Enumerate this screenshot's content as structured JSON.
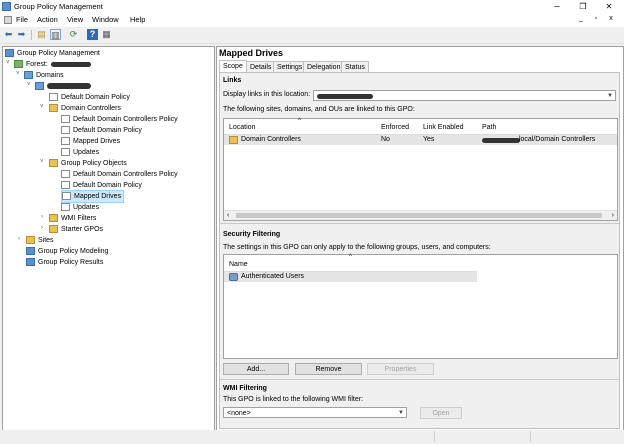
{
  "window": {
    "title": "Group Policy Management",
    "minimize": "─",
    "restore": "❐",
    "close": "✕"
  },
  "menu": {
    "items": [
      "File",
      "Action",
      "View",
      "Window",
      "Help"
    ],
    "mdi_min": "_",
    "mdi_restore": "▫",
    "mdi_close": "x"
  },
  "toolbar": {
    "back": "⬅",
    "forward": "➡",
    "up": "▤",
    "show_hide": "▥",
    "refresh": "⟳",
    "help": "?",
    "console": "▦"
  },
  "tree": {
    "root": "Group Policy Management",
    "forest": "Forest:",
    "domains": "Domains",
    "domain_name": "",
    "default_domain_policy": "Default Domain Policy",
    "domain_controllers": "Domain Controllers",
    "dc_items": [
      "Default Domain Controllers Policy",
      "Default Domain Policy",
      "Mapped Drives",
      "Updates"
    ],
    "gpo_folder": "Group Policy Objects",
    "gpo_items": [
      "Default Domain Controllers Policy",
      "Default Domain Policy",
      "Mapped Drives",
      "Updates"
    ],
    "wmi_filters": "WMI Filters",
    "starter_gpos": "Starter GPOs",
    "sites": "Sites",
    "modeling": "Group Policy Modeling",
    "results": "Group Policy Results"
  },
  "details": {
    "title": "Mapped Drives",
    "tabs": [
      "Scope",
      "Details",
      "Settings",
      "Delegation",
      "Status"
    ],
    "links": {
      "heading": "Links",
      "display_label": "Display links in this location:",
      "display_value": "",
      "desc": "The following sites, domains, and OUs are linked to this GPO:",
      "columns": [
        "Location",
        "Enforced",
        "Link Enabled",
        "Path"
      ],
      "rows": [
        {
          "location": "Domain Controllers",
          "enforced": "No",
          "link_enabled": "Yes",
          "path": ".local/Domain Controllers"
        }
      ]
    },
    "security": {
      "heading": "Security Filtering",
      "desc": "The settings in this GPO can only apply to the following groups, users, and computers:",
      "column": "Name",
      "rows": [
        "Authenticated Users"
      ],
      "buttons": {
        "add": "Add...",
        "remove": "Remove",
        "properties": "Properties"
      }
    },
    "wmi": {
      "heading": "WMI Filtering",
      "desc": "This GPO is linked to the following WMI filter:",
      "value": "<none>",
      "open": "Open"
    }
  }
}
